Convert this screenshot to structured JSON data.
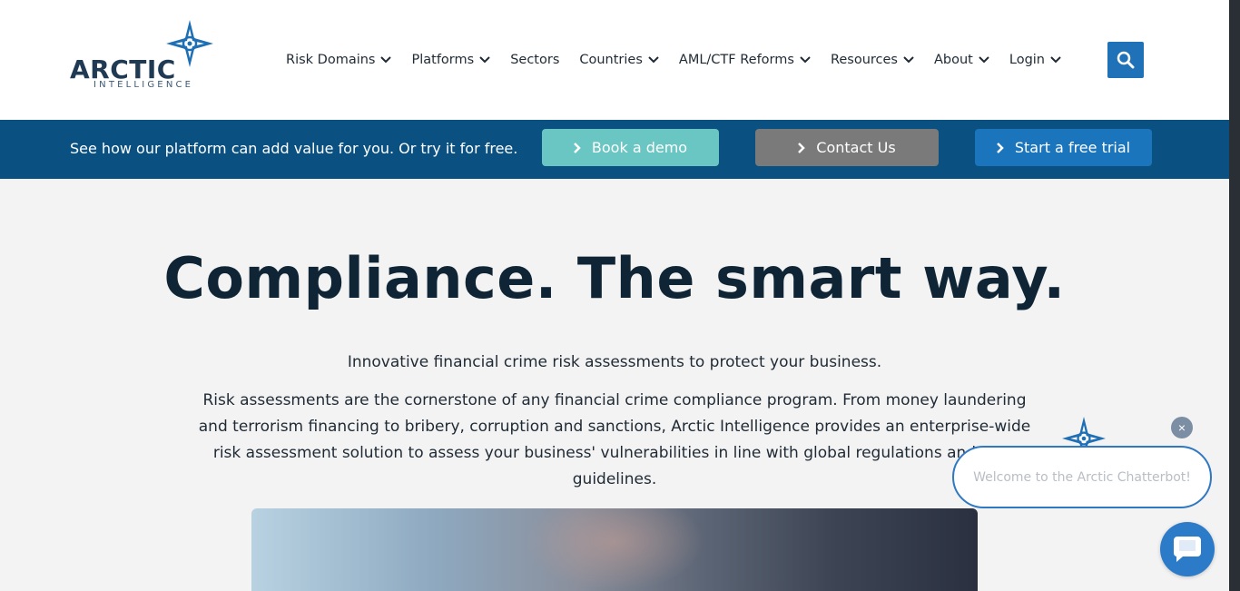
{
  "logo": {
    "word": "ARCTIC",
    "sub": "INTELLIGENCE"
  },
  "nav": {
    "items": [
      {
        "label": "Risk Domains",
        "dropdown": true
      },
      {
        "label": "Platforms",
        "dropdown": true
      },
      {
        "label": "Sectors",
        "dropdown": false
      },
      {
        "label": "Countries",
        "dropdown": true
      },
      {
        "label": "AML/CTF Reforms",
        "dropdown": true
      },
      {
        "label": "Resources",
        "dropdown": true
      },
      {
        "label": "About",
        "dropdown": true
      },
      {
        "label": "Login",
        "dropdown": true
      }
    ],
    "search_icon": "search-icon"
  },
  "cta": {
    "text": "See how our platform can add value for you. Or try it for free.",
    "demo_label": "Book a demo",
    "contact_label": "Contact Us",
    "trial_label": "Start a free trial"
  },
  "hero": {
    "title": "Compliance. The smart way.",
    "subtitle": "Innovative financial crime risk assessments to protect your business.",
    "paragraph": "Risk assessments are the cornerstone of any financial crime compliance program. From money laundering and terrorism financing to bribery, corruption and sanctions, Arctic Intelligence provides an enterprise-wide risk assessment solution to assess your business' vulnerabilities in line with global regulations and FATF guidelines."
  },
  "chat": {
    "welcome": "Welcome to the Arctic Chatterbot!",
    "close_symbol": "×"
  },
  "colors": {
    "brand_dark": "#0f2535",
    "cta_bar": "#0a5182",
    "demo": "#6ac6c3",
    "contact": "#7a7a7a",
    "trial": "#1b75bd",
    "search": "#1f72b7"
  }
}
